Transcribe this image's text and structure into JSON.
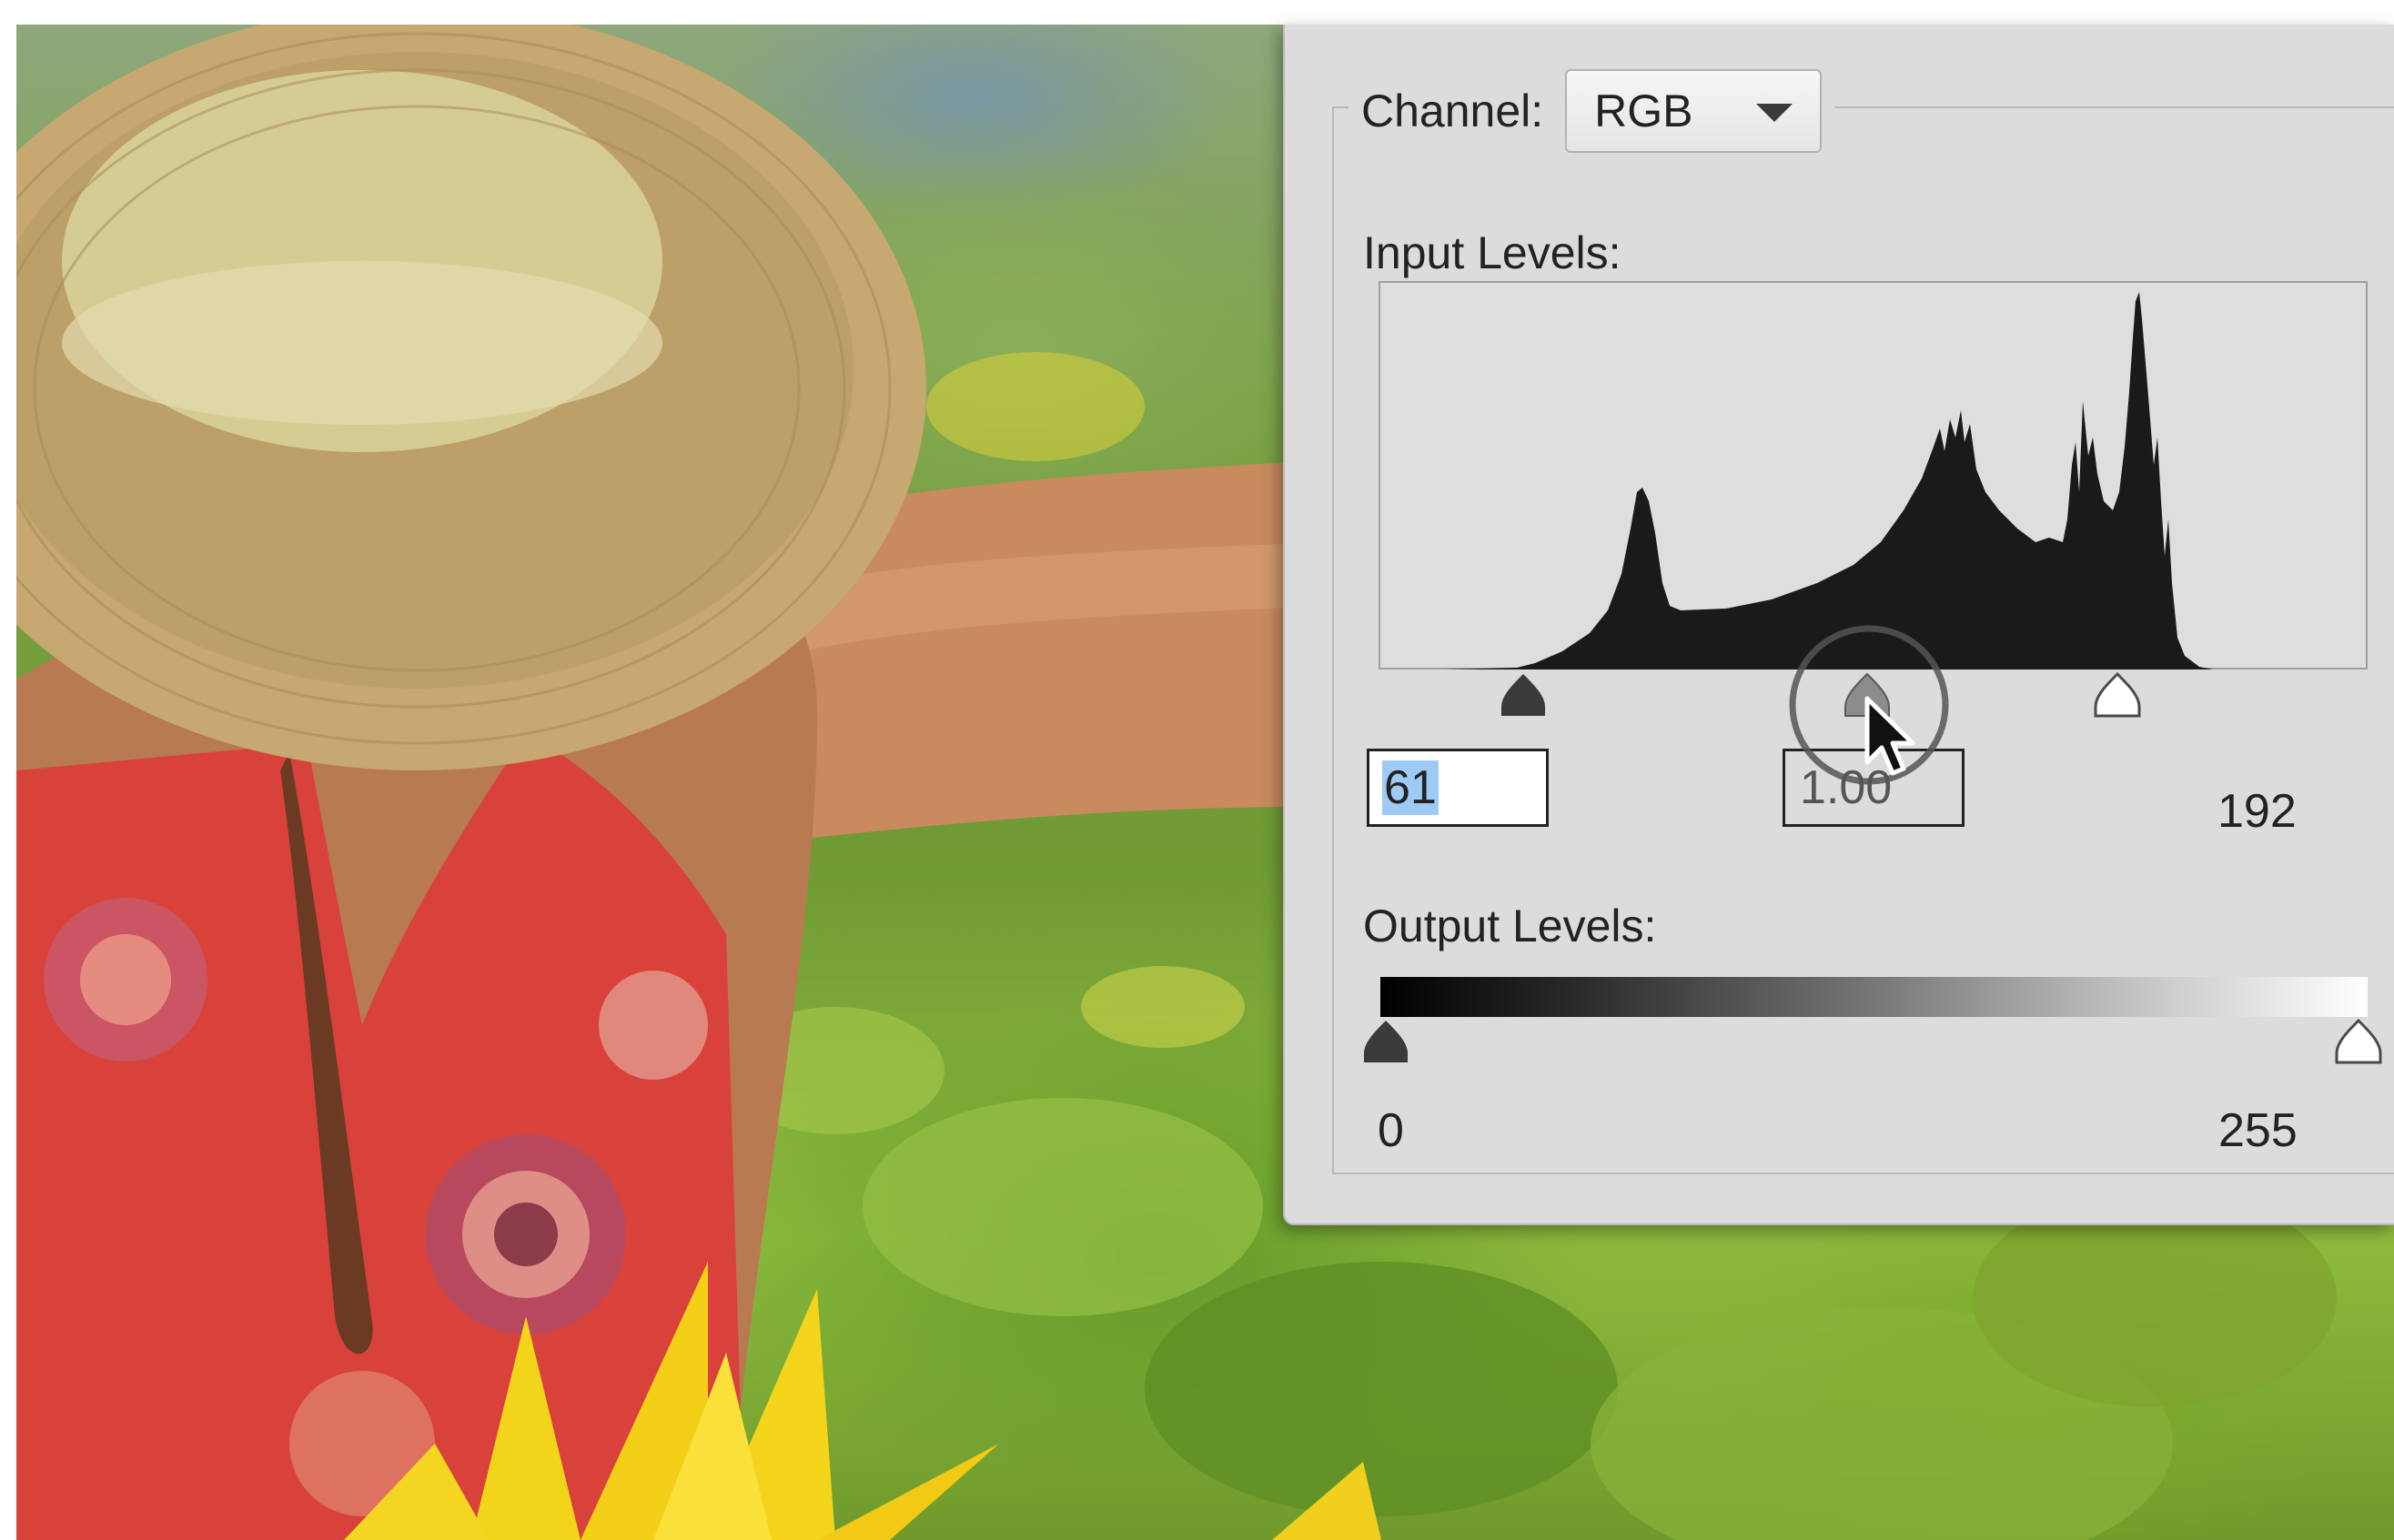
{
  "dialog": {
    "channel": {
      "label": "Channel:",
      "selected": "RGB",
      "caret_icon": "chevron-down-icon"
    },
    "input_levels": {
      "label": "Input Levels:",
      "black_point": "61",
      "gamma": "1.00",
      "white_point": "192"
    },
    "output_levels": {
      "label": "Output Levels:",
      "black_point": "0",
      "white_point": "255"
    }
  },
  "colors": {
    "dialog_bg": "#dcdcdc",
    "histogram_fill": "#1a1a1a",
    "selection_highlight": "#9ecbf6"
  },
  "cursor": {
    "icon": "mouse-pointer-icon",
    "highlight": "click-ring"
  }
}
